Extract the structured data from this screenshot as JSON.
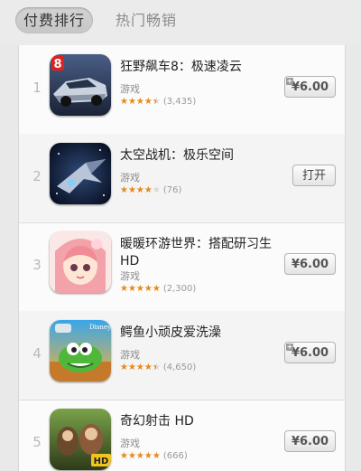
{
  "tabs": {
    "paid": "付费排行",
    "hot": "热门畅销"
  },
  "apps": [
    {
      "rank": "1",
      "name": "狂野飙车8：极速凌云",
      "category": "游戏",
      "rating": 0.9,
      "count": "(3,435)",
      "button": "¥6.00",
      "plus": true
    },
    {
      "rank": "2",
      "name": "太空战机：极乐空间",
      "category": "游戏",
      "rating": 0.8,
      "count": "(76)",
      "button": "打开",
      "plus": false
    },
    {
      "rank": "3",
      "name": "暖暖环游世界：搭配研习生HD",
      "category": "游戏",
      "rating": 1.0,
      "count": "(2,300)",
      "button": "¥6.00",
      "plus": false
    },
    {
      "rank": "4",
      "name": "鳄鱼小顽皮爱洗澡",
      "category": "游戏",
      "rating": 0.9,
      "count": "(4,650)",
      "button": "¥6.00",
      "plus": true
    },
    {
      "rank": "5",
      "name": "奇幻射击 HD",
      "category": "游戏",
      "rating": 1.0,
      "count": "(666)",
      "button": "¥6.00",
      "plus": false
    }
  ],
  "icon_labels": {
    "asphalt": "8",
    "disney": "Disney",
    "hd": "HD"
  },
  "colors": {
    "star": "#e88a17",
    "rank": "#b9b9b9"
  }
}
